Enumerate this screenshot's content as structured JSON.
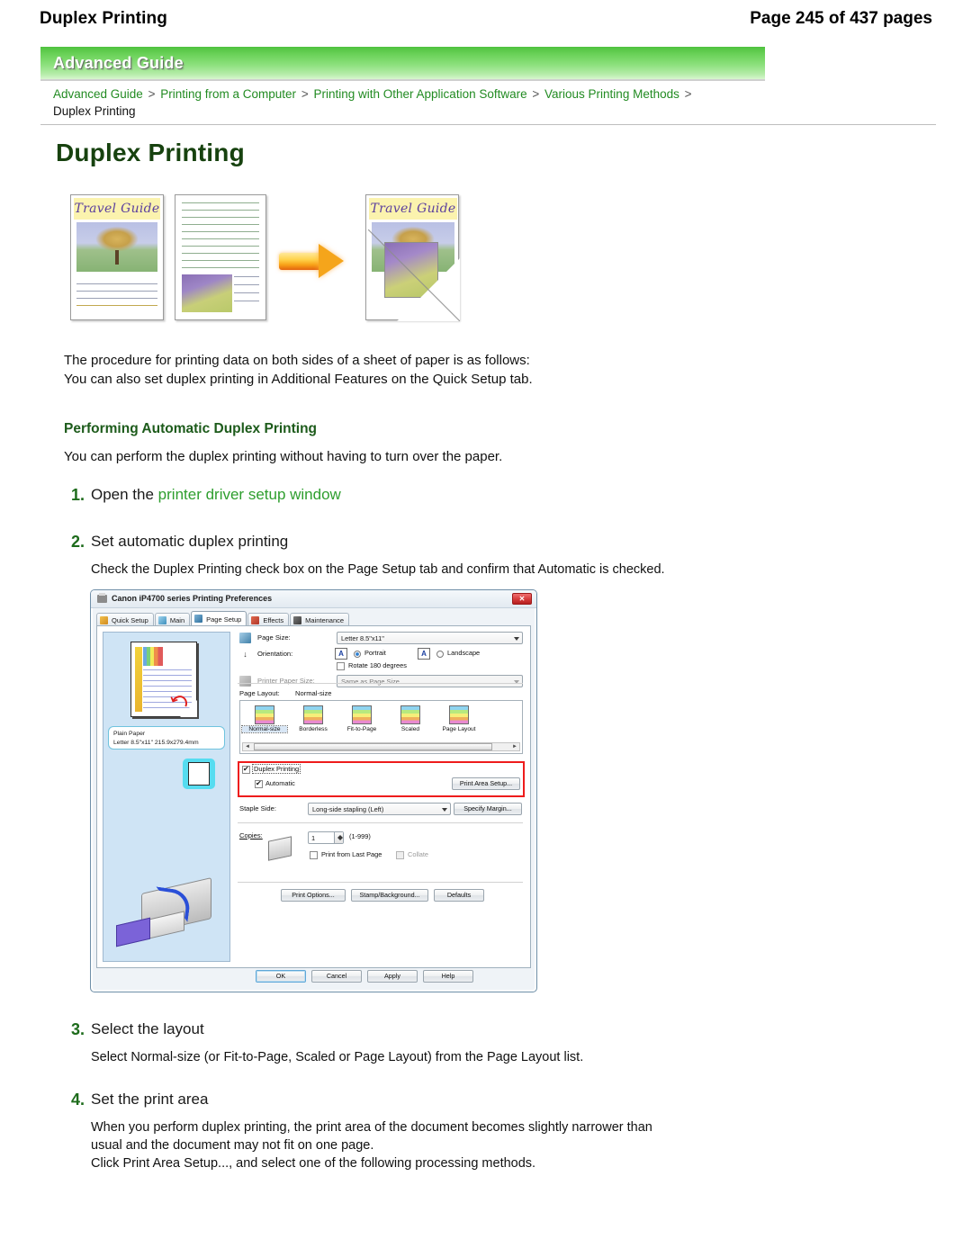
{
  "header": {
    "title": "Duplex Printing",
    "page_indicator": "Page 245 of 437 pages"
  },
  "banner": {
    "label": "Advanced Guide"
  },
  "breadcrumb": {
    "items": [
      "Advanced Guide",
      "Printing from a Computer",
      "Printing with Other Application Software",
      "Various Printing Methods"
    ],
    "separator": ">",
    "current": "Duplex Printing"
  },
  "doc": {
    "title": "Duplex Printing",
    "illustration": {
      "front_label": "Travel Guide",
      "result_label": "Travel Guide",
      "arrow": "right-arrow"
    },
    "intro_line1": "The procedure for printing data on both sides of a sheet of paper is as follows:",
    "intro_line2": "You can also set duplex printing in Additional Features on the Quick Setup tab.",
    "section_heading": "Performing Automatic Duplex Printing",
    "section_text": "You can perform the duplex printing without having to turn over the paper.",
    "steps": [
      {
        "num": "1.",
        "title_prefix": "Open the ",
        "title_link": "printer driver setup window",
        "body": ""
      },
      {
        "num": "2.",
        "title_prefix": "Set automatic duplex printing",
        "title_link": "",
        "body": "Check the Duplex Printing check box on the Page Setup tab and confirm that Automatic is checked."
      },
      {
        "num": "3.",
        "title_prefix": "Select the layout",
        "title_link": "",
        "body": "Select Normal-size (or Fit-to-Page, Scaled or Page Layout) from the Page Layout list."
      },
      {
        "num": "4.",
        "title_prefix": "Set the print area",
        "title_link": "",
        "body_line1": "When you perform duplex printing, the print area of the document becomes slightly narrower than",
        "body_line2": "usual and the document may not fit on one page.",
        "body_line3": "Click Print Area Setup..., and select one of the following processing methods."
      }
    ]
  },
  "dialog": {
    "title": "Canon iP4700 series Printing Preferences",
    "close_label": "✕",
    "tabs": [
      {
        "label": "Quick Setup",
        "selected": false
      },
      {
        "label": "Main",
        "selected": false
      },
      {
        "label": "Page Setup",
        "selected": true
      },
      {
        "label": "Effects",
        "selected": false
      },
      {
        "label": "Maintenance",
        "selected": false
      }
    ],
    "preview": {
      "tooltip_line1": "Plain Paper",
      "tooltip_line2": "Letter 8.5\"x11\" 215.9x279.4mm"
    },
    "page_size": {
      "label": "Page Size:",
      "value": "Letter 8.5\"x11\""
    },
    "orientation": {
      "label": "Orientation:",
      "portrait": "Portrait",
      "landscape": "Landscape",
      "rotate": "Rotate 180 degrees",
      "glyph": "A"
    },
    "printer_paper_size": {
      "label": "Printer Paper Size:",
      "value": "Same as Page Size"
    },
    "page_layout": {
      "label": "Page Layout:",
      "value": "Normal-size",
      "options": [
        "Normal-size",
        "Borderless",
        "Fit-to-Page",
        "Scaled",
        "Page Layout"
      ],
      "selected_index": 0
    },
    "duplex": {
      "checkbox_label": "Duplex Printing",
      "automatic_label": "Automatic",
      "print_area_button": "Print Area Setup..."
    },
    "staple": {
      "label": "Staple Side:",
      "value": "Long-side stapling (Left)",
      "margin_button": "Specify Margin..."
    },
    "copies": {
      "label": "Copies:",
      "value": "1",
      "range": "(1-999)",
      "print_last_page": "Print from Last Page",
      "collate": "Collate"
    },
    "secondary_buttons": [
      "Print Options...",
      "Stamp/Background...",
      "Defaults"
    ],
    "footer_buttons": [
      "OK",
      "Cancel",
      "Apply",
      "Help"
    ]
  },
  "colors": {
    "brand_green": "#228b22",
    "heading_green": "#17420f",
    "link_green": "#2e9e2e",
    "highlight_red": "#ee1c1c"
  }
}
